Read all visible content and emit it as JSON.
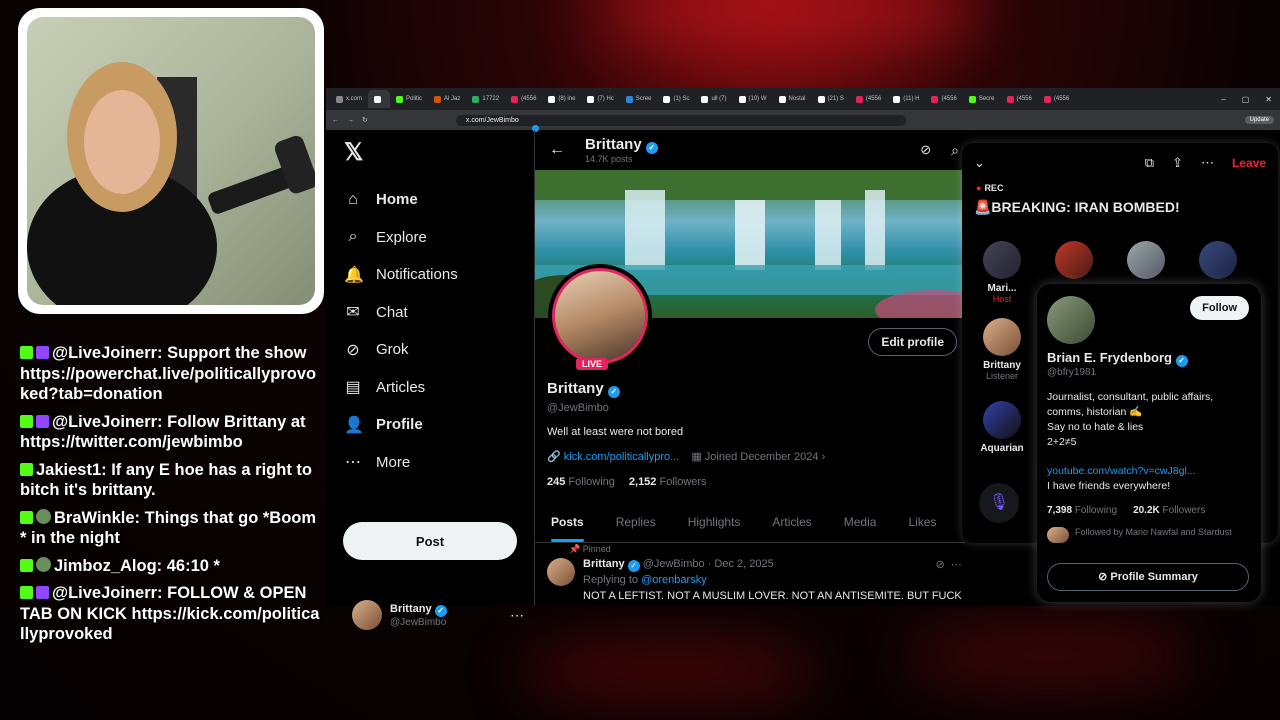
{
  "browser": {
    "tabs": [
      {
        "label": "x.com",
        "color": "#888888",
        "active": false
      },
      {
        "label": "",
        "color": "#ffffff",
        "active": true
      },
      {
        "label": "Politic",
        "color": "#53fc18",
        "active": false
      },
      {
        "label": "Al Jaz",
        "color": "#d35400",
        "active": false
      },
      {
        "label": "17722",
        "color": "#27ae60",
        "active": false
      },
      {
        "label": "(4556",
        "color": "#e0245e",
        "active": false
      },
      {
        "label": "(8) ine",
        "color": "#ffffff",
        "active": false
      },
      {
        "label": "(7) Hc",
        "color": "#ffffff",
        "active": false
      },
      {
        "label": "Scree",
        "color": "#2e86de",
        "active": false
      },
      {
        "label": "(1) Sc",
        "color": "#ffffff",
        "active": false
      },
      {
        "label": "ull (7)",
        "color": "#ffffff",
        "active": false
      },
      {
        "label": "(10) W",
        "color": "#ffffff",
        "active": false
      },
      {
        "label": "Nostal",
        "color": "#ffffff",
        "active": false
      },
      {
        "label": "(21) S",
        "color": "#ffffff",
        "active": false
      },
      {
        "label": "(4556",
        "color": "#e0245e",
        "active": false
      },
      {
        "label": "(11) H",
        "color": "#ffffff",
        "active": false
      },
      {
        "label": "(4556",
        "color": "#e0245e",
        "active": false
      },
      {
        "label": "Secre",
        "color": "#53fc18",
        "active": false
      },
      {
        "label": "(4556",
        "color": "#e0245e",
        "active": false
      },
      {
        "label": "(4556",
        "color": "#e0245e",
        "active": false
      }
    ],
    "url": "x.com/JewBimbo",
    "update_label": "Update"
  },
  "nav": {
    "items": [
      {
        "label": "Home",
        "icon": "home-icon",
        "glyph": "⌂",
        "bold": true
      },
      {
        "label": "Explore",
        "icon": "search-icon",
        "glyph": "⌕",
        "bold": false
      },
      {
        "label": "Notifications",
        "icon": "bell-icon",
        "glyph": "🔔",
        "bold": false
      },
      {
        "label": "Chat",
        "icon": "mail-icon",
        "glyph": "✉",
        "bold": false
      },
      {
        "label": "Grok",
        "icon": "grok-icon",
        "glyph": "⊘",
        "bold": false
      },
      {
        "label": "Articles",
        "icon": "articles-icon",
        "glyph": "▤",
        "bold": false
      },
      {
        "label": "Profile",
        "icon": "person-icon",
        "glyph": "👤",
        "bold": true
      },
      {
        "label": "More",
        "icon": "more-icon",
        "glyph": "⋯",
        "bold": false
      }
    ],
    "post_label": "Post",
    "account_name": "Brittany",
    "account_handle": "@JewBimbo"
  },
  "profile": {
    "header_name": "Brittany",
    "post_count": "14.7K posts",
    "live_label": "LIVE",
    "edit_label": "Edit profile",
    "name": "Brittany",
    "handle": "@JewBimbo",
    "bio": "Well at least were not bored",
    "link": "kick.com/politicallypro...",
    "joined": "Joined December 2024",
    "following_count": "245",
    "following_label": "Following",
    "followers_count": "2,152",
    "followers_label": "Followers",
    "tabs": [
      "Posts",
      "Replies",
      "Highlights",
      "Articles",
      "Media",
      "Likes"
    ]
  },
  "tweet": {
    "pinned_label": "Pinned",
    "author": "Brittany",
    "handle": "@JewBimbo",
    "date": "Dec 2, 2025",
    "replying_label": "Replying to",
    "replying_to": "@orenbarsky",
    "text": "NOT A LEFTIST. NOT A MUSLIM LOVER. NOT AN ANTISEMITE. BUT FUCK"
  },
  "space": {
    "rec_label": "REC",
    "leave_label": "Leave",
    "title": "🚨BREAKING: IRAN BOMBED!",
    "speakers": [
      {
        "name": "Mari...",
        "role": "Host"
      },
      {
        "name": "Brittany",
        "role": "Listener"
      },
      {
        "name": "Aquarian",
        "role": ""
      }
    ]
  },
  "hovercard": {
    "follow_label": "Follow",
    "name": "Brian E. Frydenborg",
    "handle": "@bfry1981",
    "bio": "Journalist, consultant, public affairs, comms, historian ✍️\nSay no to hate & lies\n2+2≠5",
    "link": "youtube.com/watch?v=cwJ8gl...",
    "friends": "I have friends everywhere!",
    "following_count": "7,398",
    "following_label": "Following",
    "followers_count": "20.2K",
    "followers_label": "Followers",
    "followed_by": "Followed by Mario Nawfal and Stardust",
    "summary_label": "Profile Summary"
  },
  "chat": [
    {
      "badges": [
        "green",
        "purple"
      ],
      "text": "@LiveJoinerr: Support the show https://powerchat.live/politicallyprovoked?tab=donation"
    },
    {
      "badges": [
        "green",
        "purple"
      ],
      "text": "@LiveJoinerr: Follow Brittany at https://twitter.com/jewbimbo"
    },
    {
      "badges": [
        "green"
      ],
      "text": "Jakiest1: If any E hoe has a right to bitch it's brittany."
    },
    {
      "badges": [
        "green",
        "gray"
      ],
      "text": "BraWinkle: Things that go *Boom* in the night"
    },
    {
      "badges": [
        "green",
        "gray"
      ],
      "text": "Jimboz_Alog: 46:10 *"
    },
    {
      "badges": [
        "green",
        "purple"
      ],
      "text": "@LiveJoinerr: FOLLOW & OPEN TAB ON KICK https://kick.com/politicallyprovoked"
    }
  ]
}
